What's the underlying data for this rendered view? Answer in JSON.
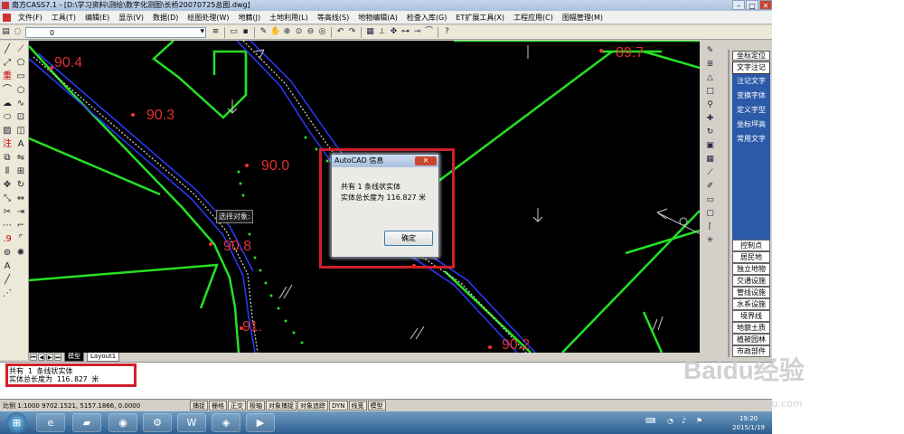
{
  "window": {
    "title": "南方CASS7.1 - [D:\\学习资料\\测绘\\数字化测图\\长桥20070725总图.dwg]"
  },
  "menu": [
    "文件(F)",
    "工具(T)",
    "编辑(E)",
    "显示(V)",
    "数据(D)",
    "绘图处理(W)",
    "地籍(J)",
    "土地利用(L)",
    "等高线(S)",
    "地物编辑(A)",
    "检查入库(G)",
    "ET扩展工具(X)",
    "工程应用(C)",
    "图幅管理(M)"
  ],
  "toolbar": {
    "layer_value": "0"
  },
  "drawing": {
    "elevations": [
      "90.4",
      "90.3",
      "90.0",
      "90.8",
      "89.7",
      "91.",
      "90.2"
    ],
    "pick_tooltip": "选择对象:"
  },
  "dialog": {
    "title": "AutoCAD 信息",
    "line1": "共有 1 条线状实体",
    "line2": "实体总长度为 116.827 米",
    "ok": "确定"
  },
  "layout_tabs": [
    "模型",
    "Layout1"
  ],
  "right_panel": {
    "header": "坐标定位",
    "blue_items": [
      "文字注记",
      "注记文字",
      "变换字体",
      "定义字型",
      "坐标坪高",
      "常用文字"
    ],
    "white_items": [
      "控制点",
      "居民地",
      "独立地物",
      "交通设施",
      "管线设施",
      "水系设施",
      "境界线",
      "地貌土质",
      "植被园林",
      "市政部件"
    ]
  },
  "command": {
    "line1": "共有 1 条线状实体",
    "line2": "实体总长度为 116.827 米"
  },
  "status": {
    "scale": "比例  1:1000  9702.1521, 5157.1866, 0.0000",
    "buttons": [
      "捕捉",
      "栅格",
      "正交",
      "极轴",
      "对象捕捉",
      "对象追踪",
      "DYN",
      "线宽",
      "模型"
    ]
  },
  "taskbar": {
    "time": "19:20",
    "date": "2015/1/19"
  },
  "watermark": {
    "logo": "Baidu经验",
    "url": "jingyan.baidu.com"
  }
}
